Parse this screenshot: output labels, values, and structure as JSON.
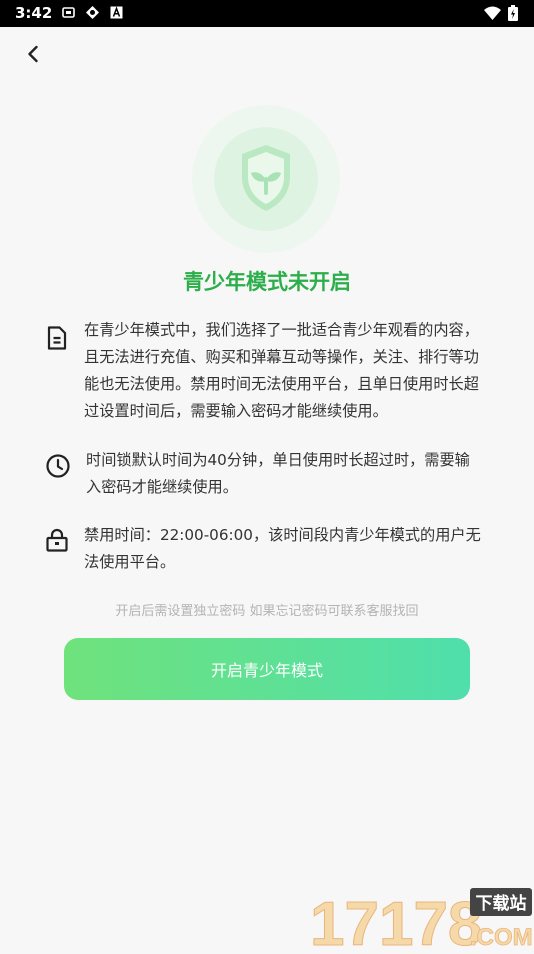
{
  "status": {
    "time": "3:42"
  },
  "title": "青少年模式未开启",
  "items": [
    {
      "icon": "document-icon",
      "text": "在青少年模式中，我们选择了一批适合青少年观看的内容，且无法进行充值、购买和弹幕互动等操作，关注、排行等功能也无法使用。禁用时间无法使用平台，且单日使用时长超过设置时间后，需要输入密码才能继续使用。"
    },
    {
      "icon": "clock-icon",
      "text": "时间锁默认时间为40分钟，单日使用时长超过时，需要输入密码才能继续使用。"
    },
    {
      "icon": "lock-icon",
      "text": "禁用时间：22:00-06:00，该时间段内青少年模式的用户无法使用平台。"
    }
  ],
  "hint": "开启后需设置独立密码 如果忘记密码可联系客服找回",
  "button_label": "开启青少年模式",
  "watermark": {
    "number": "17178",
    "label": "下载站",
    "domain": ".COM"
  },
  "colors": {
    "accent": "#2cae4a",
    "button_start": "#6fe27c",
    "button_end": "#4fdfac"
  }
}
